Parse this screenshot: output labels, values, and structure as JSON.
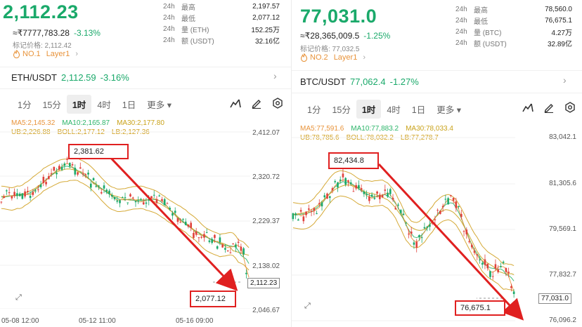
{
  "eth": {
    "price": "2,112.23",
    "fiat": "≈₹7777,783.28",
    "change": "-3.13%",
    "mark": "标记价格: 2,112.42",
    "rank": "NO.1",
    "category": "Layer1",
    "stats": [
      {
        "k1": "24h",
        "k2": "最高",
        "v": "2,197.57"
      },
      {
        "k1": "24h",
        "k2": "最低",
        "v": "2,077.12"
      },
      {
        "k1": "24h",
        "k2": "量 (ETH)",
        "v": "152.25万"
      },
      {
        "k1": "24h",
        "k2": "额 (USDT)",
        "v": "32.16亿"
      }
    ],
    "pair": "ETH/USDT",
    "pair_price": "2,112.59",
    "pair_change": "-3.16%",
    "intervals": [
      "1分",
      "15分",
      "1时",
      "4时",
      "1日",
      "更多 ▾"
    ],
    "active_interval": 2,
    "ma5": "MA5:2,145.32",
    "ma10": "MA10:2,165.87",
    "ma30": "MA30:2,177.80",
    "ub": "UB:2,226.88",
    "boll": "BOLL:2,177.12",
    "lb": "LB:2,127.36",
    "yaxis": [
      "2,412.07",
      "2,320.72",
      "2,229.37",
      "2,138.02",
      "2,046.67"
    ],
    "xaxis": [
      "05-08 12:00",
      "05-12 11:00",
      "05-16 09:00"
    ],
    "high_callout": "2,381.62",
    "low_callout": "2,077.12",
    "last_price": "2,112.23",
    "chart_data": {
      "type": "line",
      "x": [
        "05-08 12:00",
        "05-12 11:00",
        "05-16 09:00"
      ],
      "ylim": [
        2046.67,
        2412.07
      ],
      "series": [],
      "annotations": [
        {
          "label": "2,381.62",
          "kind": "high"
        },
        {
          "label": "2,077.12",
          "kind": "low"
        }
      ],
      "last": 2112.23
    }
  },
  "btc": {
    "price": "77,031.0",
    "fiat": "≈₹28,365,009.5",
    "change": "-1.25%",
    "mark": "标记价格: 77,032.5",
    "rank": "NO.2",
    "category": "Layer1",
    "stats": [
      {
        "k1": "24h",
        "k2": "最高",
        "v": "78,560.0"
      },
      {
        "k1": "24h",
        "k2": "最低",
        "v": "76,675.1"
      },
      {
        "k1": "24h",
        "k2": "量 (BTC)",
        "v": "4.27万"
      },
      {
        "k1": "24h",
        "k2": "额 (USDT)",
        "v": "32.89亿"
      }
    ],
    "pair": "BTC/USDT",
    "pair_price": "77,062.4",
    "pair_change": "-1.27%",
    "intervals": [
      "1分",
      "15分",
      "1时",
      "4时",
      "1日",
      "更多 ▾"
    ],
    "active_interval": 2,
    "ma5": "MA5:77,591.6",
    "ma10": "MA10:77,883.2",
    "ma30": "MA30:78,033.4",
    "ub": "UB:78,785.6",
    "boll": "BOLL:78,032.2",
    "lb": "LB:77,278.7",
    "yaxis": [
      "83,042.1",
      "81,305.6",
      "79,569.1",
      "77,832.7",
      "76,096.2"
    ],
    "high_callout": "82,434.8",
    "low_callout": "76,675.1",
    "last_price": "77,031.0",
    "chart_data": {
      "type": "line",
      "ylim": [
        76096.2,
        83042.1
      ],
      "series": [],
      "annotations": [
        {
          "label": "82,434.8",
          "kind": "high"
        },
        {
          "label": "76,675.1",
          "kind": "low"
        }
      ],
      "last": 77031.0
    }
  },
  "colors": {
    "up": "#1aa96a",
    "down": "#e0413c",
    "ma5": "#e8933a",
    "ma10": "#2cb56a",
    "ma30": "#c9a21a",
    "boll": "#d0a020",
    "callout": "#e02020",
    "accent": "#e8933a"
  }
}
